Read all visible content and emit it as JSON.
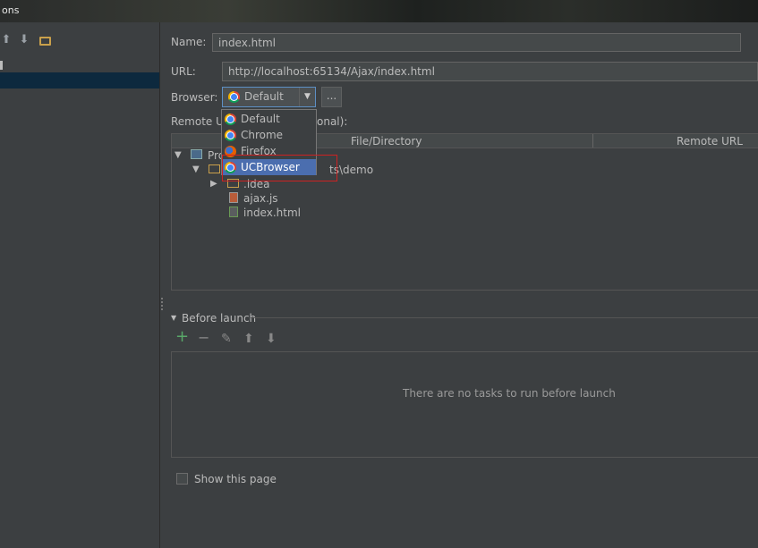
{
  "window": {
    "title": "ons"
  },
  "left_toolbar": {
    "up": "arrow-up-icon",
    "down": "arrow-down-icon",
    "folder": "folder-icon"
  },
  "form": {
    "name_label": "Name:",
    "name_value": "index.html",
    "url_label": "URL:",
    "url_value": "http://localhost:65134/Ajax/index.html",
    "browser_label": "Browser:",
    "browser_value": "Default",
    "dots_label": "...",
    "remote_label_left": "Remote UR",
    "remote_label_right": "onal):"
  },
  "browser_options": [
    {
      "label": "Default",
      "icon": "chrome-icon"
    },
    {
      "label": "Chrome",
      "icon": "chrome-icon"
    },
    {
      "label": "Firefox",
      "icon": "firefox-icon"
    },
    {
      "label": "UCBrowser",
      "icon": "chrome-icon",
      "selected": true
    }
  ],
  "table": {
    "columns": [
      "File/Directory",
      "Remote URL"
    ],
    "rows": {
      "project_partial": "Pro",
      "path_partial": "ts\\demo",
      "idea": ".idea",
      "ajax": "ajax.js",
      "index": "index.html"
    }
  },
  "before_launch": {
    "title": "Before launch",
    "empty_text": "There are no tasks to run before launch",
    "tool_icons": [
      "add-icon",
      "remove-icon",
      "edit-icon",
      "move-up-icon",
      "move-down-icon"
    ]
  },
  "show_page": {
    "label": "Show this page",
    "checked": false
  },
  "colors": {
    "accent": "#4b6eaf",
    "highlight_box": "#cc2222",
    "add": "#59a869"
  }
}
